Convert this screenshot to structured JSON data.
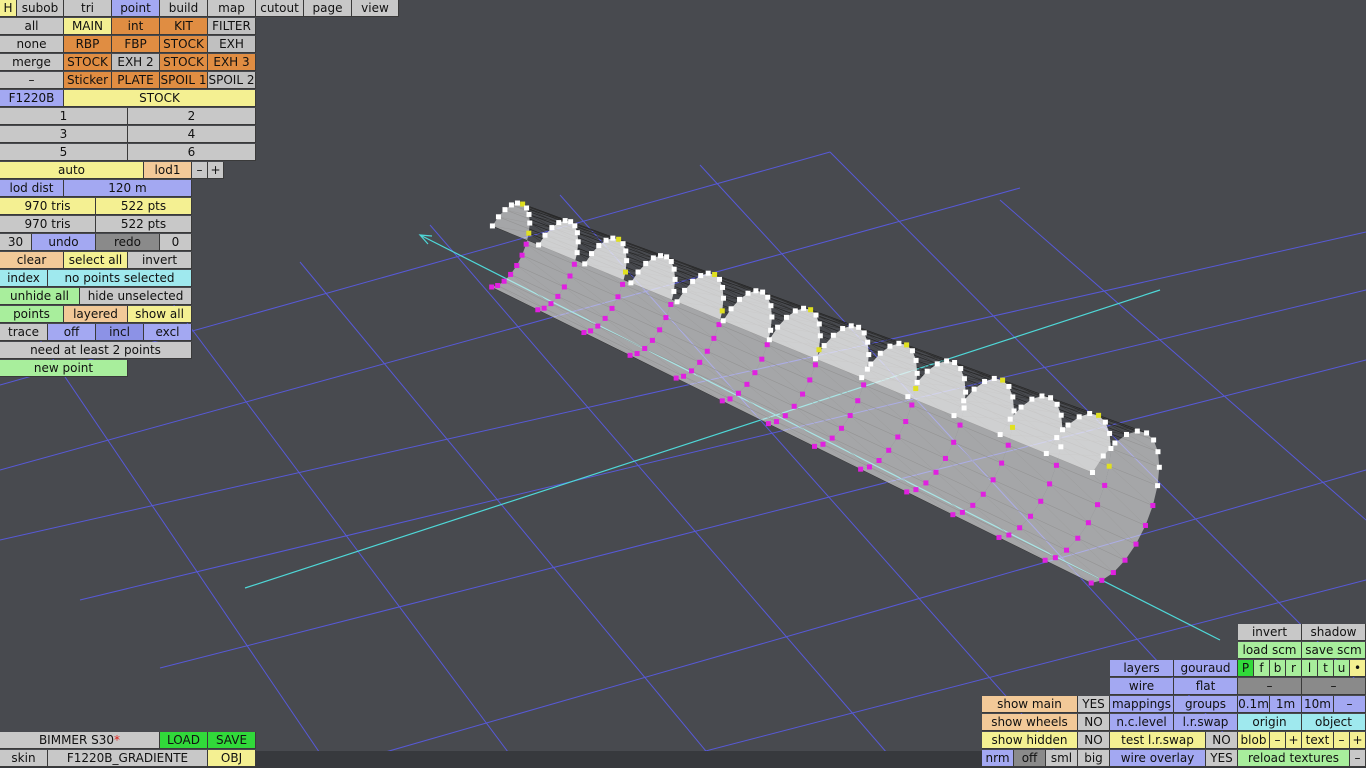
{
  "menu": {
    "h": "H",
    "subob": "subob",
    "tri": "tri",
    "point": "point",
    "build": "build",
    "map": "map",
    "cutout": "cutout",
    "page": "page",
    "view": "view"
  },
  "parts": {
    "all": "all",
    "main": "MAIN",
    "int": "int",
    "kit": "KIT",
    "filter": "FILTER",
    "none": "none",
    "rbp": "RBP",
    "fbp": "FBP",
    "stock1": "STOCK",
    "exh": "EXH",
    "merge": "merge",
    "stock2": "STOCK",
    "exh2": "EXH 2",
    "stock3": "STOCK",
    "exh3": "EXH 3",
    "dash": "–",
    "sticker": "Sticker",
    "plate": "PLATE",
    "spoil1": "SPOIL 1",
    "spoil2": "SPOIL 2"
  },
  "model": {
    "id": "F1220B",
    "variant": "STOCK"
  },
  "slots": [
    "1",
    "2",
    "3",
    "4",
    "5",
    "6"
  ],
  "lod": {
    "auto": "auto",
    "current": "lod1",
    "minus": "–",
    "plus": "+",
    "dist_label": "lod dist",
    "dist_value": "120 m"
  },
  "stats": {
    "tris1": "970 tris",
    "pts1": "522 pts",
    "tris2": "970 tris",
    "pts2": "522 pts"
  },
  "history": {
    "count": "30",
    "undo": "undo",
    "redo": "redo",
    "redo_count": "0"
  },
  "selection": {
    "clear": "clear",
    "select_all": "select all",
    "invert": "invert",
    "index": "index",
    "status": "no points selected",
    "unhide_all": "unhide all",
    "hide_unselected": "hide unselected"
  },
  "display": {
    "points": "points",
    "layered": "layered",
    "show_all": "show all",
    "trace": "trace",
    "off": "off",
    "incl": "incl",
    "excl": "excl",
    "need_points": "need at least 2 points",
    "new_point": "new point"
  },
  "file": {
    "name": "BIMMER S30",
    "modified_mark": "*",
    "load": "LOAD",
    "save": "SAVE",
    "skin_label": "skin",
    "skin_name": "F1220B_GRADIENTE",
    "obj": "OBJ"
  },
  "right_panel": {
    "invert": "invert",
    "shadow": "shadow",
    "load_scm": "load scm",
    "save_scm": "save scm",
    "layers": "layers",
    "gouraud": "gouraud",
    "wire": "wire",
    "flat": "flat",
    "views": [
      "P",
      "f",
      "b",
      "r",
      "l",
      "t",
      "u",
      "•"
    ],
    "dash1": "–",
    "dash2": "–",
    "mappings": "mappings",
    "groups": "groups",
    "s01": "0.1m",
    "s1": "1m",
    "s10": "10m",
    "sdash": "–",
    "show_main": "show main",
    "show_main_v": "YES",
    "show_wheels": "show wheels",
    "show_wheels_v": "NO",
    "show_hidden": "show hidden",
    "show_hidden_v": "NO",
    "nc_level": "n.c.level",
    "lr_swap": "l.r.swap",
    "origin": "origin",
    "object": "object",
    "test_lr_swap": "test l.r.swap",
    "test_lr_swap_v": "NO",
    "blob": "blob",
    "blob_minus": "–",
    "blob_plus": "+",
    "text": "text",
    "text_minus": "–",
    "text_plus": "+",
    "nrm": "nrm",
    "off": "off",
    "sml": "sml",
    "big": "big",
    "wire_overlay": "wire overlay",
    "wire_overlay_v": "YES",
    "reload_textures": "reload textures"
  },
  "colors": {
    "background": "#484a4f",
    "grid": "#5a5cf0",
    "axis": "#4fd8d8",
    "highlight": "#e020e0",
    "marker": "#e0e020"
  }
}
